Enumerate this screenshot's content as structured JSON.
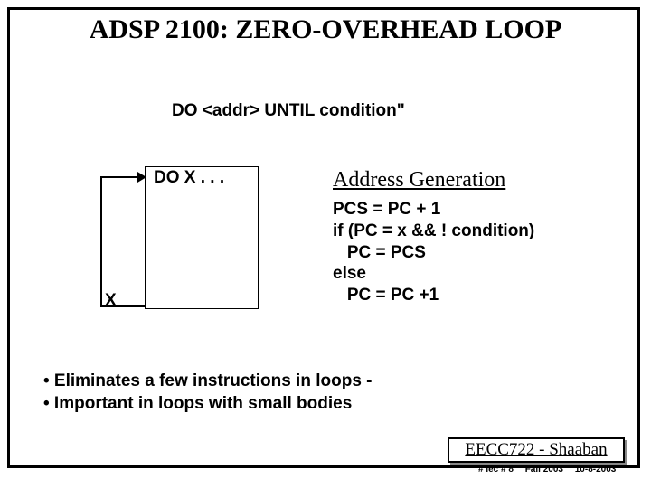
{
  "title": "ADSP 2100: ZERO-OVERHEAD LOOP",
  "syntax": "DO <addr> UNTIL condition\"",
  "loop_box_text": "DO X . . .",
  "x_label": "X",
  "address_gen_heading": "Address Generation",
  "pseudo_code": "PCS = PC + 1\nif (PC = x && ! condition)\n   PC = PCS\nelse\n   PC = PC +1",
  "bullet1": "• Eliminates a few instructions in loops -",
  "bullet2": "• Important in loops with small bodies",
  "footer": "EECC722 - Shaaban",
  "subfooter_lec": "#  lec # 8",
  "subfooter_term": "Fall 2003",
  "subfooter_date": "10-8-2003"
}
